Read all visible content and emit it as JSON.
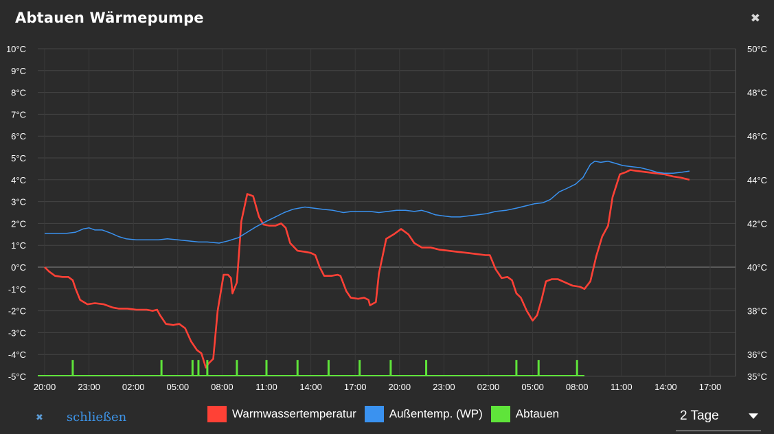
{
  "dialog": {
    "title": "Abtauen Wärmepumpe",
    "close_icon": "close-icon",
    "footer_close_label": "schließen"
  },
  "range_select": {
    "value": "2 Tage"
  },
  "chart_data": {
    "type": "line",
    "title": "",
    "left_axis": {
      "min": -5,
      "max": 10,
      "step": 1,
      "tick_labels": [
        "-5°C",
        "-4°C",
        "-3°C",
        "-2°C",
        "-1°C",
        "0°C",
        "1°C",
        "2°C",
        "3°C",
        "4°C",
        "5°C",
        "6°C",
        "7°C",
        "8°C",
        "9°C",
        "10°C"
      ]
    },
    "right_axis": {
      "min": 35,
      "max": 50,
      "ticks": [
        35,
        36,
        38,
        40,
        42,
        44,
        46,
        48,
        50
      ],
      "tick_labels": [
        "35°C",
        "36°C",
        "38°C",
        "40°C",
        "42°C",
        "44°C",
        "46°C",
        "48°C",
        "50°C"
      ]
    },
    "x_axis": {
      "min": 0,
      "max": 47.5,
      "unit": "hours since first tick",
      "ticks": [
        0,
        3,
        6,
        9,
        12,
        15,
        18,
        21,
        24,
        27,
        30,
        33,
        36,
        39,
        42,
        45
      ],
      "tick_labels": [
        "20:00",
        "23:00",
        "02:00",
        "05:00",
        "08:00",
        "11:00",
        "14:00",
        "17:00",
        "20:00",
        "23:00",
        "02:00",
        "05:00",
        "08:00",
        "11:00",
        "14:00",
        "17:00"
      ]
    },
    "grid": true,
    "legend_position": "bottom",
    "series": [
      {
        "name": "Warmwassertemperatur",
        "color": "#ff4136",
        "axis": "left",
        "points": [
          [
            0,
            0.0
          ],
          [
            0.3,
            -0.2
          ],
          [
            0.7,
            -0.4
          ],
          [
            1.2,
            -0.45
          ],
          [
            1.6,
            -0.45
          ],
          [
            1.9,
            -0.6
          ],
          [
            2.1,
            -1.0
          ],
          [
            2.4,
            -1.5
          ],
          [
            2.9,
            -1.7
          ],
          [
            3.4,
            -1.65
          ],
          [
            4.0,
            -1.7
          ],
          [
            4.6,
            -1.85
          ],
          [
            5.0,
            -1.9
          ],
          [
            5.6,
            -1.9
          ],
          [
            6.2,
            -1.95
          ],
          [
            6.9,
            -1.95
          ],
          [
            7.3,
            -2.0
          ],
          [
            7.6,
            -1.95
          ],
          [
            7.8,
            -2.2
          ],
          [
            8.2,
            -2.6
          ],
          [
            8.7,
            -2.65
          ],
          [
            9.1,
            -2.6
          ],
          [
            9.5,
            -2.8
          ],
          [
            9.9,
            -3.4
          ],
          [
            10.3,
            -3.8
          ],
          [
            10.6,
            -3.95
          ],
          [
            10.9,
            -4.6
          ],
          [
            11.1,
            -4.4
          ],
          [
            11.4,
            -4.2
          ],
          [
            11.7,
            -2.0
          ],
          [
            12.1,
            -0.35
          ],
          [
            12.4,
            -0.35
          ],
          [
            12.6,
            -0.5
          ],
          [
            12.7,
            -1.2
          ],
          [
            13.0,
            -0.7
          ],
          [
            13.3,
            2.1
          ],
          [
            13.7,
            3.35
          ],
          [
            14.1,
            3.25
          ],
          [
            14.5,
            2.3
          ],
          [
            14.8,
            1.95
          ],
          [
            15.2,
            1.9
          ],
          [
            15.6,
            1.9
          ],
          [
            16.0,
            2.0
          ],
          [
            16.3,
            1.8
          ],
          [
            16.6,
            1.1
          ],
          [
            17.1,
            0.75
          ],
          [
            17.6,
            0.7
          ],
          [
            18.0,
            0.65
          ],
          [
            18.3,
            0.55
          ],
          [
            18.6,
            0.0
          ],
          [
            18.9,
            -0.4
          ],
          [
            19.4,
            -0.4
          ],
          [
            19.8,
            -0.35
          ],
          [
            20.0,
            -0.4
          ],
          [
            20.4,
            -1.1
          ],
          [
            20.7,
            -1.4
          ],
          [
            21.2,
            -1.45
          ],
          [
            21.6,
            -1.4
          ],
          [
            21.9,
            -1.5
          ],
          [
            22.0,
            -1.75
          ],
          [
            22.4,
            -1.6
          ],
          [
            22.6,
            -0.3
          ],
          [
            23.1,
            1.3
          ],
          [
            23.6,
            1.5
          ],
          [
            24.1,
            1.75
          ],
          [
            24.6,
            1.5
          ],
          [
            25.0,
            1.1
          ],
          [
            25.5,
            0.9
          ],
          [
            26.1,
            0.9
          ],
          [
            26.7,
            0.8
          ],
          [
            27.3,
            0.75
          ],
          [
            27.9,
            0.7
          ],
          [
            28.6,
            0.65
          ],
          [
            29.2,
            0.6
          ],
          [
            29.8,
            0.55
          ],
          [
            30.1,
            0.55
          ],
          [
            30.5,
            -0.1
          ],
          [
            30.9,
            -0.5
          ],
          [
            31.3,
            -0.45
          ],
          [
            31.6,
            -0.6
          ],
          [
            31.9,
            -1.2
          ],
          [
            32.2,
            -1.4
          ],
          [
            32.6,
            -2.0
          ],
          [
            33.0,
            -2.45
          ],
          [
            33.3,
            -2.2
          ],
          [
            33.6,
            -1.5
          ],
          [
            33.9,
            -0.65
          ],
          [
            34.3,
            -0.55
          ],
          [
            34.7,
            -0.55
          ],
          [
            35.2,
            -0.7
          ],
          [
            35.7,
            -0.85
          ],
          [
            36.2,
            -0.9
          ],
          [
            36.5,
            -1.0
          ],
          [
            36.9,
            -0.65
          ],
          [
            37.3,
            0.5
          ],
          [
            37.7,
            1.4
          ],
          [
            38.1,
            1.9
          ],
          [
            38.4,
            3.2
          ],
          [
            38.9,
            4.25
          ],
          [
            39.3,
            4.35
          ],
          [
            39.6,
            4.45
          ],
          [
            40.1,
            4.4
          ],
          [
            40.7,
            4.35
          ],
          [
            41.3,
            4.3
          ],
          [
            41.9,
            4.25
          ],
          [
            42.5,
            4.15
          ],
          [
            43.0,
            4.1
          ],
          [
            43.6,
            4.0
          ]
        ]
      },
      {
        "name": "Außentemp. (WP)",
        "color": "#3a92f0",
        "axis": "left",
        "points": [
          [
            0,
            1.55
          ],
          [
            1.5,
            1.55
          ],
          [
            2.1,
            1.6
          ],
          [
            2.6,
            1.75
          ],
          [
            3.0,
            1.8
          ],
          [
            3.4,
            1.7
          ],
          [
            3.9,
            1.7
          ],
          [
            4.5,
            1.55
          ],
          [
            5.0,
            1.4
          ],
          [
            5.5,
            1.3
          ],
          [
            6.2,
            1.25
          ],
          [
            6.9,
            1.25
          ],
          [
            7.7,
            1.25
          ],
          [
            8.3,
            1.3
          ],
          [
            9.0,
            1.25
          ],
          [
            9.7,
            1.2
          ],
          [
            10.4,
            1.15
          ],
          [
            11.0,
            1.15
          ],
          [
            11.8,
            1.1
          ],
          [
            12.4,
            1.2
          ],
          [
            13.1,
            1.35
          ],
          [
            13.7,
            1.6
          ],
          [
            14.3,
            1.85
          ],
          [
            15.0,
            2.1
          ],
          [
            15.6,
            2.3
          ],
          [
            16.2,
            2.5
          ],
          [
            16.8,
            2.65
          ],
          [
            17.6,
            2.75
          ],
          [
            18.2,
            2.7
          ],
          [
            18.8,
            2.65
          ],
          [
            19.5,
            2.6
          ],
          [
            20.2,
            2.5
          ],
          [
            20.8,
            2.55
          ],
          [
            21.4,
            2.55
          ],
          [
            22.0,
            2.55
          ],
          [
            22.6,
            2.5
          ],
          [
            23.2,
            2.55
          ],
          [
            23.8,
            2.6
          ],
          [
            24.4,
            2.6
          ],
          [
            25.0,
            2.55
          ],
          [
            25.5,
            2.6
          ],
          [
            26.0,
            2.5
          ],
          [
            26.4,
            2.4
          ],
          [
            26.9,
            2.35
          ],
          [
            27.5,
            2.3
          ],
          [
            28.1,
            2.3
          ],
          [
            28.7,
            2.35
          ],
          [
            29.3,
            2.4
          ],
          [
            29.9,
            2.45
          ],
          [
            30.5,
            2.55
          ],
          [
            31.2,
            2.6
          ],
          [
            31.9,
            2.7
          ],
          [
            32.5,
            2.8
          ],
          [
            33.1,
            2.9
          ],
          [
            33.7,
            2.95
          ],
          [
            34.2,
            3.1
          ],
          [
            34.8,
            3.45
          ],
          [
            35.3,
            3.6
          ],
          [
            35.9,
            3.8
          ],
          [
            36.4,
            4.1
          ],
          [
            36.9,
            4.7
          ],
          [
            37.2,
            4.85
          ],
          [
            37.6,
            4.8
          ],
          [
            38.1,
            4.85
          ],
          [
            38.6,
            4.75
          ],
          [
            39.1,
            4.65
          ],
          [
            39.7,
            4.6
          ],
          [
            40.3,
            4.55
          ],
          [
            40.9,
            4.45
          ],
          [
            41.4,
            4.35
          ],
          [
            41.9,
            4.3
          ],
          [
            42.5,
            4.3
          ],
          [
            43.1,
            4.35
          ],
          [
            43.6,
            4.4
          ]
        ]
      },
      {
        "name": "Abtauen",
        "color": "#5fe43a",
        "axis": "left",
        "baseline": -5,
        "events": [
          1.9,
          7.9,
          10.0,
          10.4,
          11.0,
          13.0,
          15.0,
          17.1,
          19.2,
          21.3,
          23.4,
          25.8,
          31.9,
          33.4,
          36.0
        ]
      }
    ]
  }
}
